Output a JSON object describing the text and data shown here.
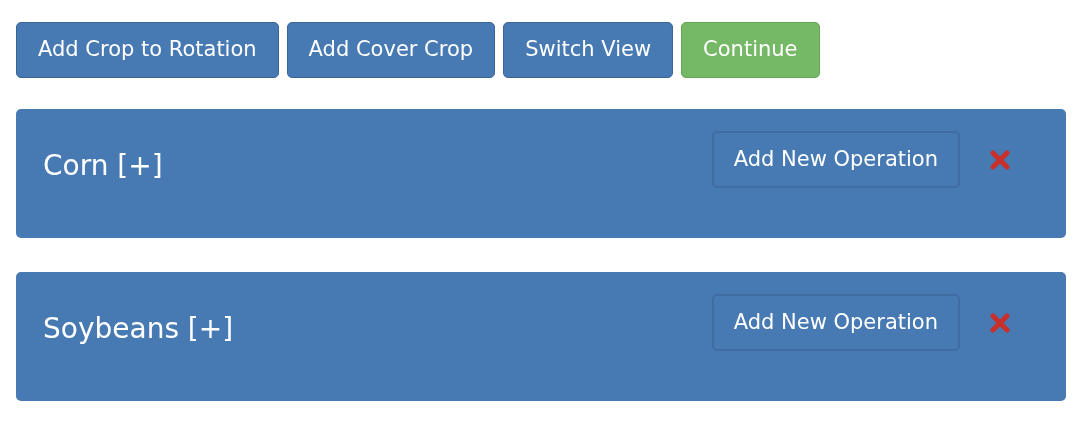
{
  "toolbar": [
    {
      "label": "Add Crop to Rotation",
      "kind": "primary"
    },
    {
      "label": "Add Cover Crop",
      "kind": "primary"
    },
    {
      "label": "Switch View",
      "kind": "primary"
    },
    {
      "label": "Continue",
      "kind": "success"
    }
  ],
  "crops": [
    {
      "title": "Corn [+]",
      "action": "Add New Operation"
    },
    {
      "title": "Soybeans [+]",
      "action": "Add New Operation"
    }
  ]
}
